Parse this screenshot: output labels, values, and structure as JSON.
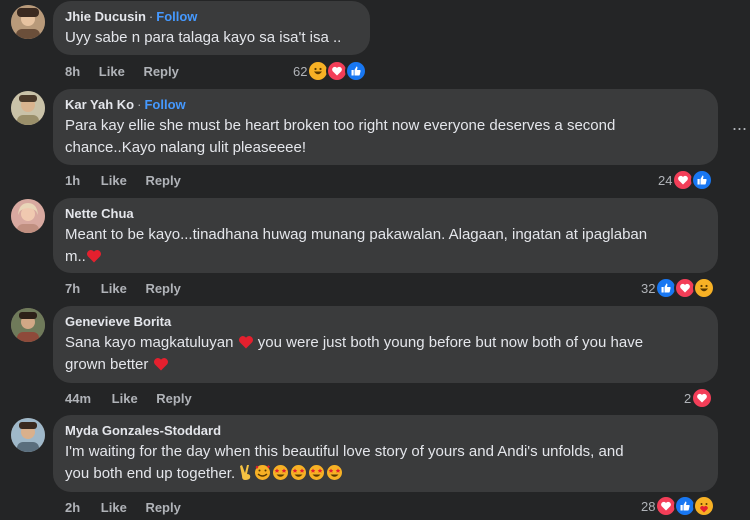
{
  "comments": [
    {
      "name": "Jhie Ducusin",
      "follow": "Follow",
      "text": "Uyy sabe n para talaga kayo sa isa't isa ..",
      "time": "8h",
      "like": "Like",
      "reply": "Reply",
      "reaction_count": "62",
      "reactions": [
        "haha-icon",
        "love-icon",
        "like-icon"
      ]
    },
    {
      "name": "Kar Yah Ko",
      "follow": "Follow",
      "text_line1": "Para kay ellie she must be heart broken too right now everyone deserves a second",
      "text_line2": "chance..Kayo nalang ulit pleaseeee!",
      "time": "1h",
      "like": "Like",
      "reply": "Reply",
      "reaction_count": "24",
      "reactions": [
        "love-icon",
        "like-icon"
      ]
    },
    {
      "name": "Nette Chua",
      "text_line1": "Meant to be kayo...tinadhana huwag munang pakawalan. Alagaan, ingatan at ipaglaban",
      "text_line2": "m..",
      "time": "7h",
      "like": "Like",
      "reply": "Reply",
      "reaction_count": "32",
      "reactions": [
        "like-icon",
        "love-icon",
        "haha-icon"
      ]
    },
    {
      "name": "Genevieve Borita",
      "text_line1a": "Sana kayo magkatuluyan",
      "text_line1b": "you were just both young before but now both of you have",
      "text_line2": "grown better",
      "time": "44m",
      "like": "Like",
      "reply": "Reply",
      "reaction_count": "2",
      "reactions": [
        "love-icon"
      ]
    },
    {
      "name": "Myda Gonzales-Stoddard",
      "text_line1": "I'm waiting for the day when this beautiful love story of yours and Andi's unfolds, and",
      "text_line2": "you both end up together.",
      "time": "2h",
      "like": "Like",
      "reply": "Reply",
      "reaction_count": "28",
      "reactions": [
        "love-icon",
        "like-icon",
        "care-icon"
      ]
    }
  ],
  "more_options": "···",
  "colors": {
    "background": "#242526",
    "bubble": "#3a3b3c",
    "follow": "#4599ff",
    "like": "#1877f2",
    "love": "#f33e58",
    "haha": "#f7b125"
  }
}
